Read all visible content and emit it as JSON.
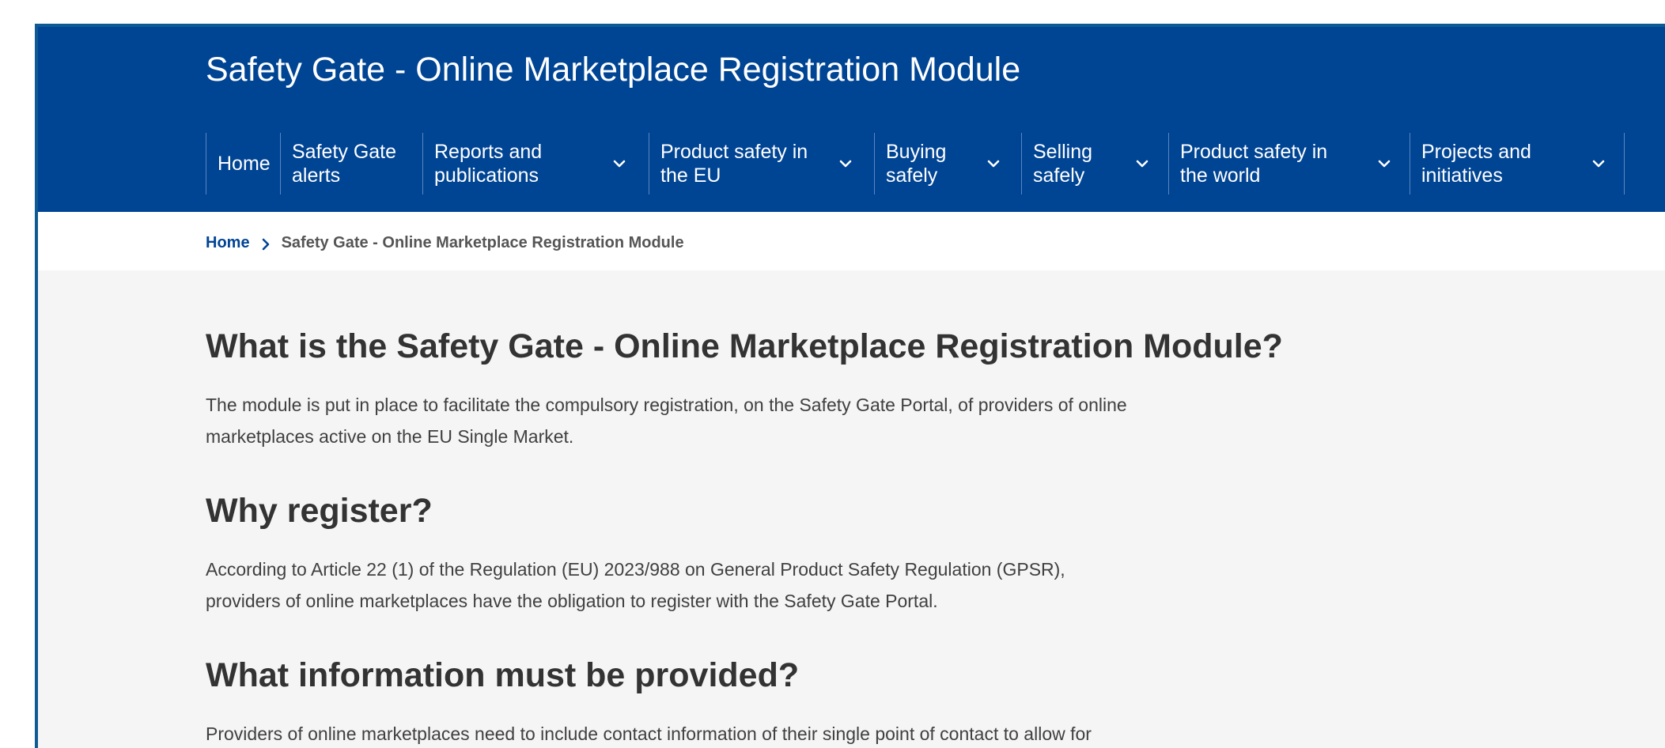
{
  "header": {
    "site_title": "Safety Gate - Online Marketplace Registration Module"
  },
  "nav": {
    "items": [
      {
        "label": "Home",
        "has_dropdown": false
      },
      {
        "label": "Safety Gate alerts",
        "has_dropdown": false
      },
      {
        "label": "Reports and publications",
        "has_dropdown": true
      },
      {
        "label": "Product safety in the EU",
        "has_dropdown": true
      },
      {
        "label": "Buying safely",
        "has_dropdown": true
      },
      {
        "label": "Selling safely",
        "has_dropdown": true
      },
      {
        "label": "Product safety in the world",
        "has_dropdown": true
      },
      {
        "label": "Projects and initiatives",
        "has_dropdown": true
      }
    ],
    "dropdown_icon": "chevron-down-icon"
  },
  "breadcrumb": {
    "home": "Home",
    "separator_icon": "chevron-right-icon",
    "current": "Safety Gate - Online Marketplace Registration Module"
  },
  "sections": [
    {
      "heading": "What is the Safety Gate - Online Marketplace Registration Module?",
      "body": "The module is put in place to facilitate the compulsory registration, on the Safety Gate Portal, of providers of online marketplaces active on the EU Single Market."
    },
    {
      "heading": "Why register?",
      "body": "According to Article 22 (1) of the Regulation (EU) 2023/988 on General Product Safety Regulation (GPSR), providers of online marketplaces have the obligation to register with the Safety Gate Portal."
    },
    {
      "heading": "What information must be provided?",
      "body": "Providers of online marketplaces need to include contact information of their single point of contact to allow for direct communication with national market surveillance."
    }
  ],
  "colors": {
    "header_bg": "#004494",
    "link": "#004494",
    "heading": "#333333",
    "body_text": "#404040",
    "page_bg": "#f5f5f5"
  }
}
